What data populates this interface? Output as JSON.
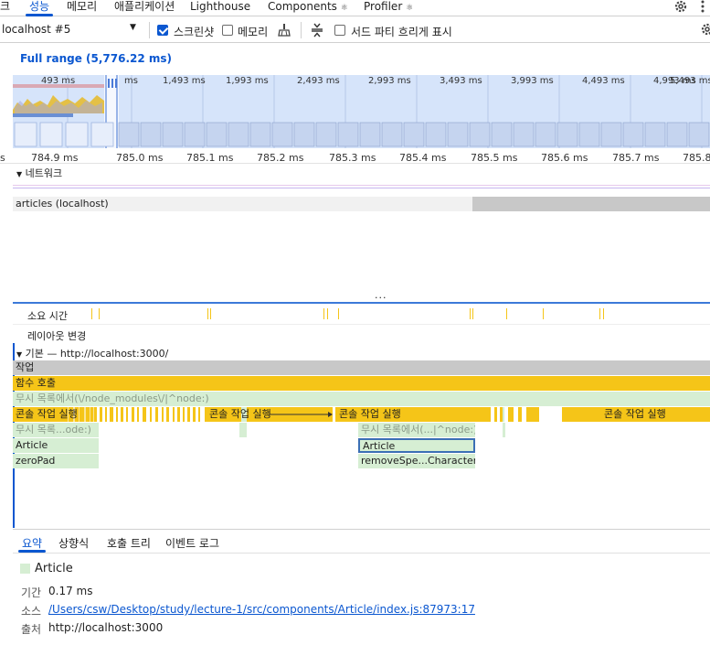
{
  "tabs": {
    "items": [
      {
        "label": "크"
      },
      {
        "label": "성능"
      },
      {
        "label": "메모리"
      },
      {
        "label": "애플리케이션"
      },
      {
        "label": "Lighthouse"
      },
      {
        "label": "Components"
      },
      {
        "label": "Profiler"
      }
    ],
    "active_index": 1
  },
  "toolbar": {
    "target_select": "localhost #5",
    "screenshot_label": "스크린샷",
    "screenshot_checked": true,
    "memory_label": "메모리",
    "memory_checked": false,
    "third_party_label": "서드 파티 흐리게 표시",
    "third_party_checked": false
  },
  "range": {
    "label": "Full range (5,776.22 ms)"
  },
  "overview": {
    "ticks": [
      "493 ms",
      "ms",
      "1,493 ms",
      "1,993 ms",
      "2,493 ms",
      "2,993 ms",
      "3,493 ms",
      "3,993 ms",
      "4,493 ms",
      "4,993 ms",
      "5,493 ms"
    ]
  },
  "ruler": {
    "ticks": [
      "s",
      "784.9 ms",
      "785.0 ms",
      "785.1 ms",
      "785.2 ms",
      "785.3 ms",
      "785.4 ms",
      "785.5 ms",
      "785.6 ms",
      "785.7 ms",
      "785.8"
    ]
  },
  "tracks": {
    "network": "네트워크",
    "articles": "articles (localhost)",
    "duration": "소요 시간",
    "layout_shift": "레이아웃 변경",
    "main": "기본 — http://localhost:3000/"
  },
  "flame": {
    "task": "작업",
    "function_call": "함수 호출",
    "ignore_list": "무시 목록에서(\\/node_modules\\/|^node:)",
    "console_run": "콘솔 작업 실행",
    "ignore_short_left": "무시 목록...ode:)",
    "ignore_short_right": "무시 목록에서(...|^node:)",
    "article": "Article",
    "zeropad": "zeroPad",
    "remove_spe": "removeSpe...Character"
  },
  "bottom": {
    "tabs": [
      "요약",
      "상향식",
      "호출 트리",
      "이벤트 로그"
    ],
    "active_index": 0,
    "summary": {
      "title": "Article",
      "duration_label": "기간",
      "duration_value": "0.17 ms",
      "source_label": "소스",
      "source_value": "/Users/csw/Desktop/study/lecture-1/src/components/Article/index.js:87973:17",
      "origin_label": "출처",
      "origin_value": "http://localhost:3000"
    }
  },
  "colors": {
    "accent": "#0b57d0",
    "task_gray": "#c8c8c8",
    "function_yellow": "#f5c518",
    "ignore_green": "#d6eed3",
    "overview_blue": "#d6e4fa"
  }
}
